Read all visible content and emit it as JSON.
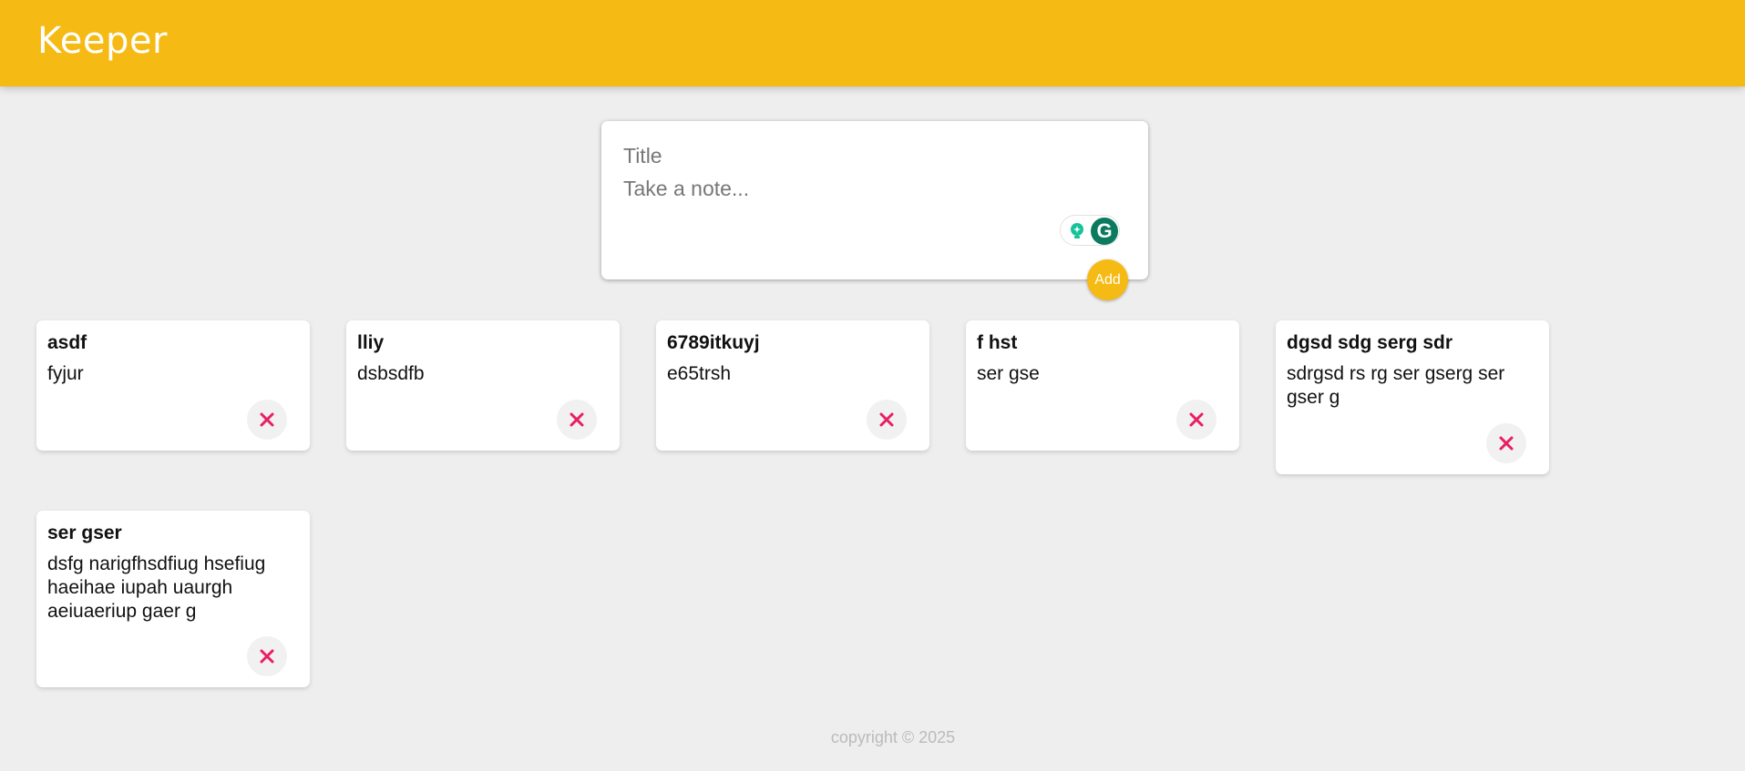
{
  "app": {
    "title": "Keeper"
  },
  "composer": {
    "title_placeholder": "Title",
    "content_placeholder": "Take a note...",
    "add_label": "Add"
  },
  "notes": [
    {
      "title": "asdf",
      "content": "fyjur"
    },
    {
      "title": "lliy",
      "content": "dsbsdfb"
    },
    {
      "title": "6789itkuyj",
      "content": "e65trsh"
    },
    {
      "title": "f hst",
      "content": "ser gse"
    },
    {
      "title": "dgsd sdg serg sdr",
      "content": "sdrgsd rs rg ser gserg ser gser g"
    },
    {
      "title": "ser gser",
      "content": "dsfg narigfhsdfiug hsefiug haeihae iupah uaurgh aeiuaeriup gaer g"
    }
  ],
  "footer": {
    "text": "copyright © 2025"
  },
  "colors": {
    "accent": "#f5ba13",
    "delete": "#e91e63",
    "background": "#eeeeee"
  },
  "icons": {
    "delete": "close-icon",
    "grammarly": "grammarly-icon",
    "bulb": "lightbulb-icon"
  }
}
